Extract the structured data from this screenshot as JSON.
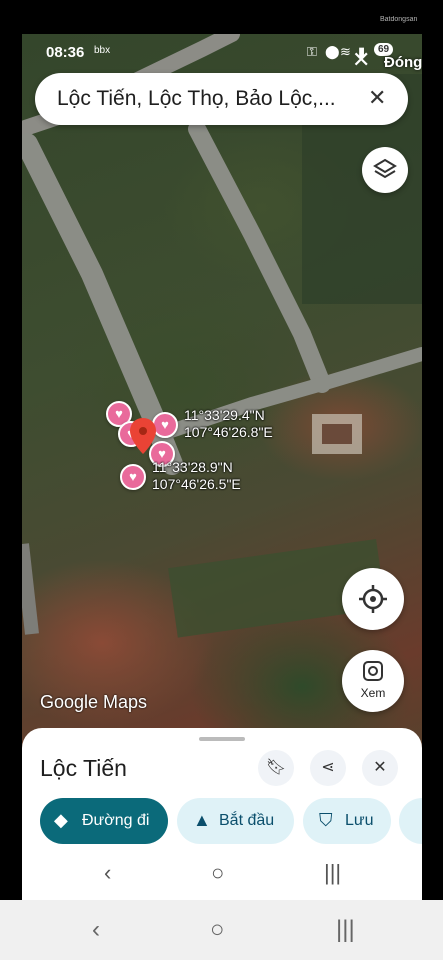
{
  "status": {
    "time": "08:36",
    "notif_icon": "bbx",
    "battery": "69"
  },
  "ad": {
    "close_label": "Đóng",
    "watermark": "Batdongsan"
  },
  "search": {
    "value": "Lộc Tiến, Lộc Thọ, Bảo Lộc,..."
  },
  "map": {
    "coord1_lat": "11°33'29.4\"N",
    "coord1_lon": "107°46'26.8\"E",
    "coord2_lat": "11°33'28.9\"N",
    "coord2_lon": "107°46'26.5\"E",
    "logo": "Google Maps",
    "view_label": "Xem"
  },
  "sheet": {
    "title": "Lộc Tiến",
    "chips": [
      {
        "label": "Đường đi"
      },
      {
        "label": "Bắt đầu"
      },
      {
        "label": "Lưu"
      }
    ]
  },
  "colors": {
    "primary_chip": "#0b6a7a",
    "secondary_chip": "#dff2f7",
    "pin": "#ea4335",
    "heart": "#e96a9b"
  }
}
